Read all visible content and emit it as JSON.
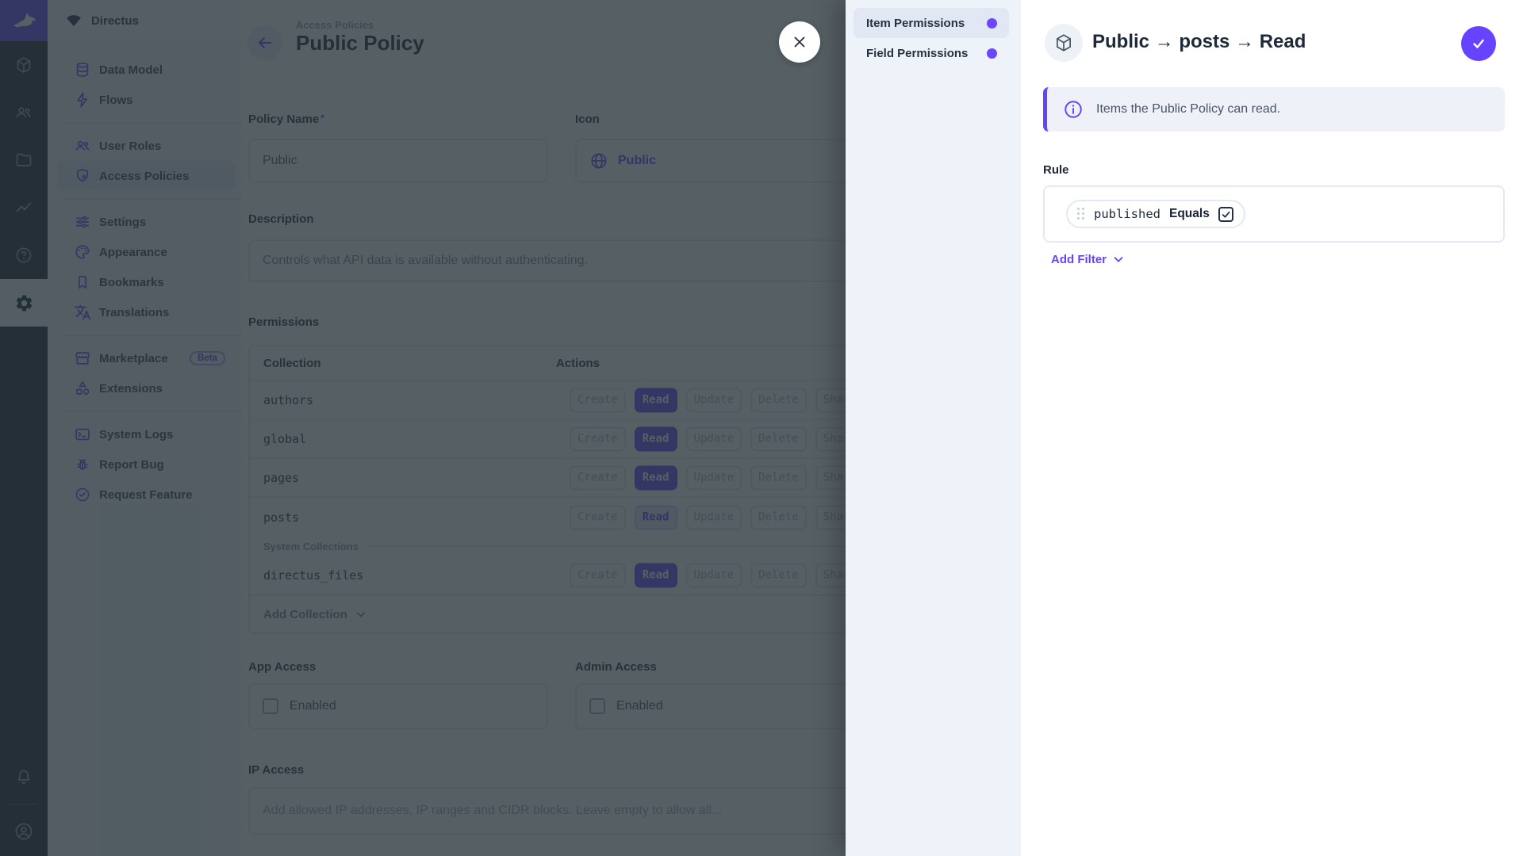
{
  "app": {
    "project_name": "Directus"
  },
  "module_bar": {
    "modules": [
      "rabbit-logo-icon",
      "box-icon",
      "people-icon",
      "folder-icon",
      "activity-icon",
      "help-icon",
      "gear-icon"
    ],
    "active_module": "settings",
    "bottom_icons": [
      "bell-icon",
      "user-circle-icon"
    ]
  },
  "nav": {
    "items": [
      {
        "label": "Data Model"
      },
      {
        "label": "Flows"
      },
      {
        "label": "User Roles"
      },
      {
        "label": "Access Policies",
        "active": true
      },
      {
        "label": "Settings"
      },
      {
        "label": "Appearance"
      },
      {
        "label": "Bookmarks"
      },
      {
        "label": "Translations"
      },
      {
        "label": "Marketplace",
        "badge": "Beta"
      },
      {
        "label": "Extensions"
      },
      {
        "label": "System Logs"
      },
      {
        "label": "Report Bug"
      },
      {
        "label": "Request Feature"
      }
    ]
  },
  "page": {
    "breadcrumb": "Access Policies",
    "title": "Public Policy"
  },
  "form": {
    "required_mark": "*",
    "policy_name": {
      "label": "Policy Name",
      "value": "Public"
    },
    "icon": {
      "label": "Icon",
      "value": "Public"
    },
    "description": {
      "label": "Description",
      "value": "Controls what API data is available without authenticating."
    }
  },
  "permissions": {
    "label": "Permissions",
    "columns": [
      "Collection",
      "Actions"
    ],
    "actions": [
      "Create",
      "Read",
      "Update",
      "Delete",
      "Share"
    ],
    "rows": [
      {
        "collection": "authors",
        "read_state": "full"
      },
      {
        "collection": "global",
        "read_state": "full"
      },
      {
        "collection": "pages",
        "read_state": "full"
      },
      {
        "collection": "posts",
        "read_state": "custom"
      },
      {
        "collection": "directus_files",
        "read_state": "full",
        "group": "system"
      }
    ],
    "system_label": "System Collections",
    "add_collection": "Add Collection"
  },
  "access": {
    "app": {
      "label": "App Access",
      "checkbox_label": "Enabled",
      "checked": false
    },
    "admin": {
      "label": "Admin Access",
      "checkbox_label": "Enabled",
      "checked": false
    },
    "ip": {
      "label": "IP Access",
      "placeholder": "Add allowed IP addresses, IP ranges and CIDR blocks. Leave empty to allow all..."
    }
  },
  "drawer": {
    "tabs": [
      {
        "label": "Item Permissions",
        "active": true
      },
      {
        "label": "Field Permissions",
        "active": false
      }
    ],
    "title": "Public → posts → Read",
    "notice": "Items the Public Policy can read.",
    "rule_label": "Rule",
    "filter": {
      "field": "published",
      "operator": "Equals",
      "value_checked": true
    },
    "add_filter_label": "Add Filter"
  },
  "colors": {
    "accent": "#6644ff",
    "navy": "#1e2a3a",
    "panel": "#f0f4fa"
  }
}
